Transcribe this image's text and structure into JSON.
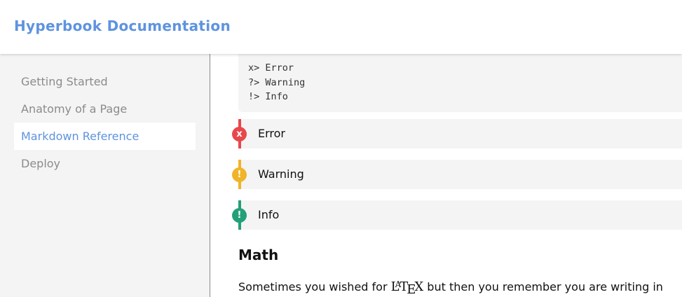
{
  "header": {
    "title": "Hyperbook Documentation"
  },
  "sidebar": {
    "items": [
      {
        "label": "Getting Started",
        "active": false
      },
      {
        "label": "Anatomy of a Page",
        "active": false
      },
      {
        "label": "Markdown Reference",
        "active": true
      },
      {
        "label": "Deploy",
        "active": false
      }
    ]
  },
  "main": {
    "code_lines": [
      "x> Error",
      "?> Warning",
      "!> Info"
    ],
    "callouts": [
      {
        "label": "Error",
        "badge": "x",
        "color": "#e8474c"
      },
      {
        "label": "Warning",
        "badge": "!",
        "color": "#f0b429"
      },
      {
        "label": "Info",
        "badge": "!",
        "color": "#23a078"
      }
    ],
    "math_heading": "Math",
    "math_paragraph": {
      "before": "Sometimes you wished for ",
      "latex": "LaTeX",
      "after": " but then you remember you are writing in"
    }
  },
  "colors": {
    "accent": "#5e93e0",
    "sidebar_bg": "#f4f4f4",
    "muted_text": "#8b8b8b"
  }
}
